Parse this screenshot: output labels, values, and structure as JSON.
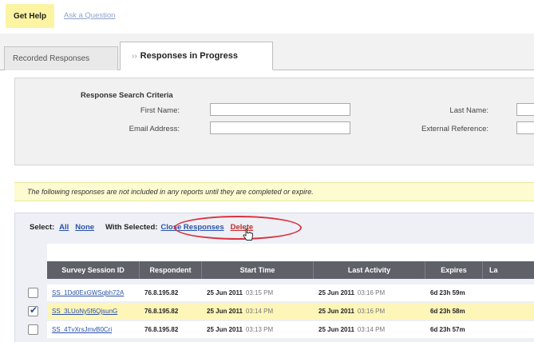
{
  "top": {
    "get_help": "Get Help",
    "ask_question": "Ask a Question"
  },
  "tabs": [
    {
      "label": "Recorded Responses",
      "active": false
    },
    {
      "label": "Responses in Progress",
      "active": true
    }
  ],
  "criteria": {
    "title": "Response Search Criteria",
    "first_name_label": "First Name:",
    "last_name_label": "Last Name:",
    "email_label": "Email Address:",
    "external_ref_label": "External Reference:"
  },
  "notice": "The following responses are not included in any reports until they are completed or expire.",
  "select_bar": {
    "select_label": "Select:",
    "all": "All",
    "none": "None",
    "with_selected": "With Selected:",
    "close_responses": "Close Responses",
    "delete": "Delete"
  },
  "table": {
    "headers": [
      "Survey Session ID",
      "Respondent",
      "Start Time",
      "Last Activity",
      "Expires",
      "La"
    ],
    "rows": [
      {
        "checked": false,
        "session_id": "SS_1Dd0ExGWSqbh72A",
        "respondent": "76.8.195.82",
        "start_date": "25 Jun 2011",
        "start_time": "03:15 PM",
        "last_date": "25 Jun 2011",
        "last_time": "03:16 PM",
        "expires": "6d 23h 59m"
      },
      {
        "checked": true,
        "session_id": "SS_3LUoNy5f6QjsunG",
        "respondent": "76.8.195.82",
        "start_date": "25 Jun 2011",
        "start_time": "03:14 PM",
        "last_date": "25 Jun 2011",
        "last_time": "03:16 PM",
        "expires": "6d 23h 58m"
      },
      {
        "checked": false,
        "session_id": "SS_4TvXrsJmvB0Cri",
        "respondent": "76.8.195.82",
        "start_date": "25 Jun 2011",
        "start_time": "03:13 PM",
        "last_date": "25 Jun 2011",
        "last_time": "03:14 PM",
        "expires": "6d 23h 57m"
      }
    ]
  },
  "colors": {
    "get_help_bg": "#fcf4a3",
    "link": "#2b52a8",
    "delete": "#c62828",
    "oval": "#d9333f",
    "header_bg": "#5e6168",
    "selected_row": "#fdf6b8"
  }
}
